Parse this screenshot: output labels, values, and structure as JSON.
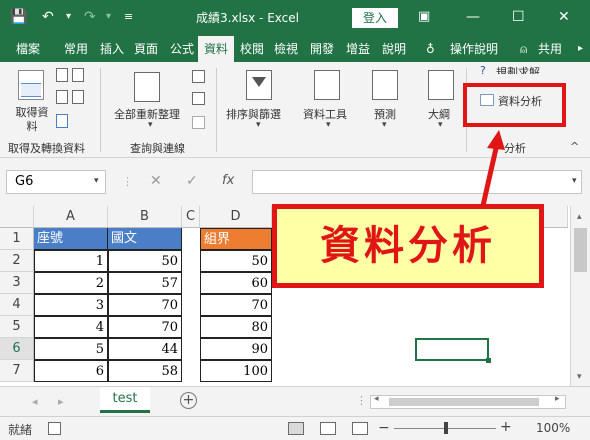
{
  "titlebar": {
    "title": "成績3.xlsx  -  Excel",
    "login": "登入",
    "bg": "#217346"
  },
  "tabs": [
    "檔案",
    "常用",
    "插入",
    "頁面",
    "公式",
    "資料",
    "校閱",
    "檢視",
    "開發",
    "增益",
    "說明",
    "操作說明",
    "共用"
  ],
  "ribbon": {
    "get_data": "取得資\n料",
    "refresh_all": "全部重新整理",
    "sort_filter": "排序與篩選",
    "data_tools": "資料工具",
    "forecast": "預測",
    "outline": "大綱",
    "solver_partial": "規劃求解",
    "data_analysis": "資料分析",
    "group_get_transform": "取得及轉換資料",
    "group_queries": "查詢與連線",
    "group_analysis": "分析"
  },
  "formula_bar": {
    "name_box": "G6",
    "fx": "fx",
    "value": ""
  },
  "columns": [
    "A",
    "B",
    "C",
    "D"
  ],
  "rows": [
    {
      "n": "1",
      "a": "座號",
      "b": "國文",
      "d": "組界"
    },
    {
      "n": "2",
      "a": "1",
      "b": "50",
      "d": "50"
    },
    {
      "n": "3",
      "a": "2",
      "b": "57",
      "d": "60"
    },
    {
      "n": "4",
      "a": "3",
      "b": "70",
      "d": "70"
    },
    {
      "n": "5",
      "a": "4",
      "b": "70",
      "d": "80"
    },
    {
      "n": "6",
      "a": "5",
      "b": "44",
      "d": "90"
    },
    {
      "n": "7",
      "a": "6",
      "b": "58",
      "d": "100"
    }
  ],
  "sheet_tab": "test",
  "status": {
    "ready": "就緒",
    "zoom": "100%"
  },
  "callout": "資料分析",
  "colors": {
    "header_blue": "#4a7fc8",
    "header_orange": "#ed7d31",
    "callout_red": "#e01515",
    "callout_fill": "#ffffa6"
  }
}
